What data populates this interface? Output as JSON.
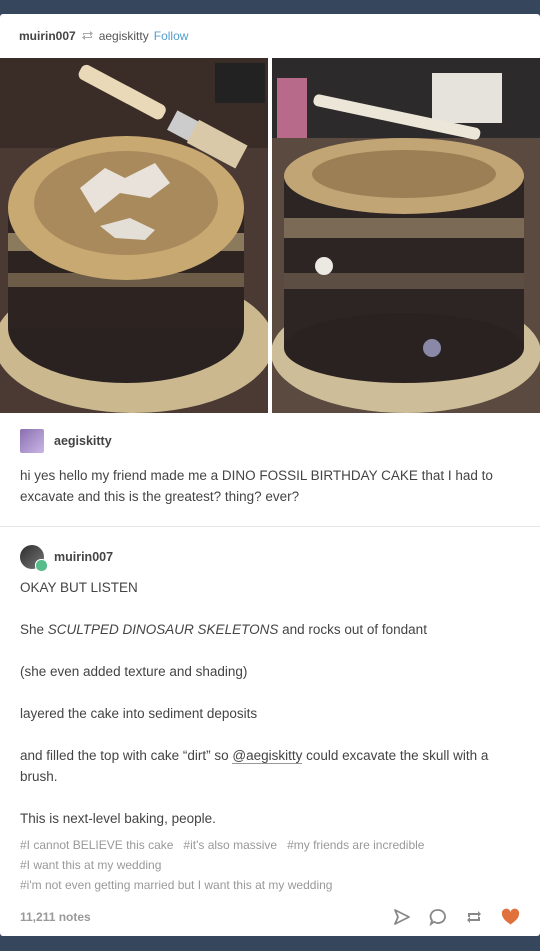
{
  "header": {
    "reblogger": "muirin007",
    "source": "aegiskitty",
    "follow_label": "Follow"
  },
  "original_post": {
    "username": "aegiskitty",
    "text": "hi yes hello my friend made me a DINO FOSSIL BIRTHDAY CAKE that I had to excavate and this is the greatest? thing? ever?"
  },
  "reblog_post": {
    "username": "muirin007",
    "lines": {
      "l1": "OKAY BUT LISTEN",
      "l2_prefix": "She ",
      "l2_italic": "SCULTPED DINOSAUR SKELETONS",
      "l2_suffix": " and rocks out of fondant",
      "l3": "(she even added texture and shading)",
      "l4": "layered the cake into sediment deposits",
      "l5_prefix": "and filled the top with cake “dirt” so ",
      "l5_mention": "@aegiskitty",
      "l5_suffix": " could excavate the skull with a brush.",
      "l6": "This is next-level baking, people."
    }
  },
  "tags": [
    "#I cannot BELIEVE this cake",
    "#it's also massive",
    "#my friends are incredible",
    "#I want this at my wedding",
    "#i'm not even getting married but I want this at my wedding"
  ],
  "footer": {
    "notes": "11,211 notes"
  },
  "colors": {
    "dashboard_bg": "#36465d",
    "follow_blue": "#529ecc",
    "like_orange": "#e0703c"
  }
}
